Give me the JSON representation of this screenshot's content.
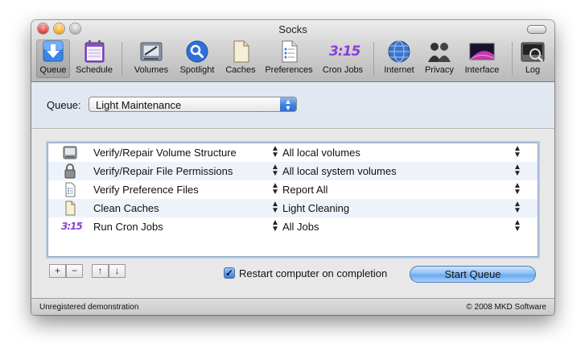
{
  "window": {
    "title": "Socks"
  },
  "toolbar": {
    "items": [
      {
        "label": "Queue",
        "icon": "download-arrow-icon"
      },
      {
        "label": "Schedule",
        "icon": "calendar-icon"
      },
      {
        "label": "Volumes",
        "icon": "hard-drive-icon"
      },
      {
        "label": "Spotlight",
        "icon": "magnifier-icon"
      },
      {
        "label": "Caches",
        "icon": "cache-file-icon"
      },
      {
        "label": "Preferences",
        "icon": "preferences-file-icon"
      },
      {
        "label": "Cron Jobs",
        "icon": "cron-clock-icon"
      },
      {
        "label": "Internet",
        "icon": "globe-icon"
      },
      {
        "label": "Privacy",
        "icon": "people-silhouette-icon"
      },
      {
        "label": "Interface",
        "icon": "desktop-icon"
      },
      {
        "label": "Log",
        "icon": "log-magnifier-icon"
      }
    ],
    "cron_glyph": "3:15"
  },
  "queue": {
    "label": "Queue:",
    "selected": "Light Maintenance"
  },
  "tasks": [
    {
      "name": "Verify/Repair Volume Structure",
      "value": "All local volumes"
    },
    {
      "name": "Verify/Repair File Permissions",
      "value": "All local system volumes"
    },
    {
      "name": "Verify Preference Files",
      "value": "Report All"
    },
    {
      "name": "Clean Caches",
      "value": "Light Cleaning"
    },
    {
      "name": "Run Cron Jobs",
      "value": "All Jobs"
    }
  ],
  "controls": {
    "add": "+",
    "remove": "−",
    "up": "↑",
    "down": "↓",
    "restart_label": "Restart computer on completion",
    "restart_checked": true,
    "start_label": "Start Queue"
  },
  "status": {
    "left": "Unregistered demonstration",
    "right": "© 2008 MKD Software"
  },
  "colors": {
    "accent": "#3b7fdc",
    "row_alt": "#eef3fb"
  }
}
